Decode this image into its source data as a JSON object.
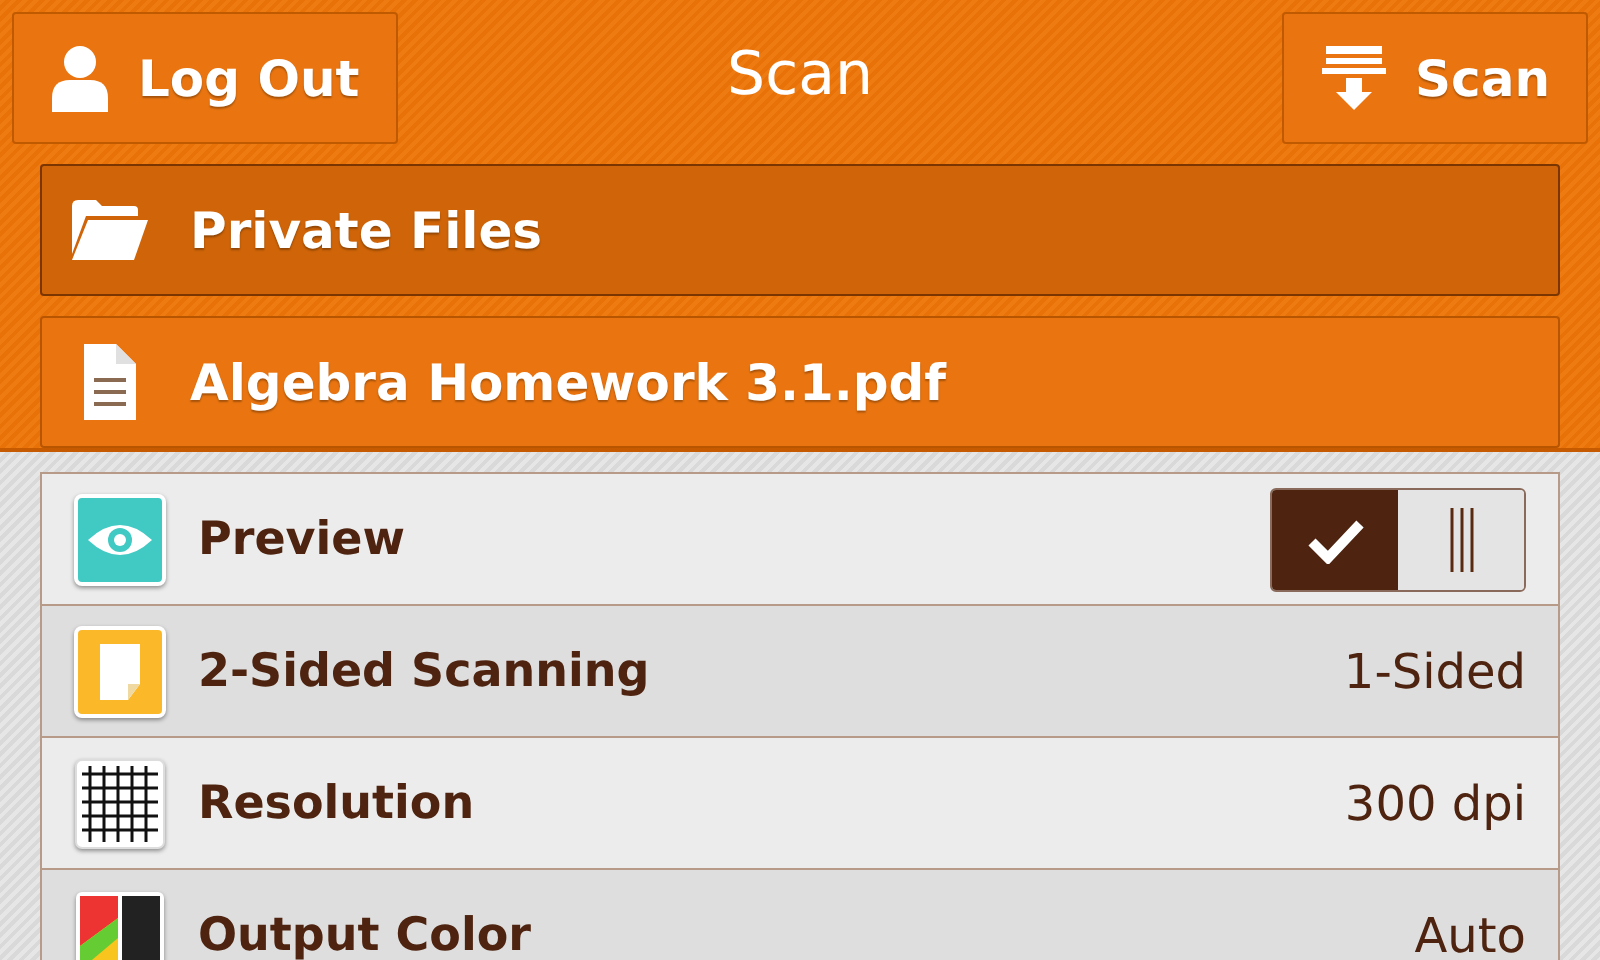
{
  "header": {
    "title": "Scan",
    "logout_button": "Log Out",
    "scan_button": "Scan"
  },
  "locations": [
    {
      "kind": "folder",
      "label": "Private Files",
      "selected": true
    },
    {
      "kind": "document",
      "label": "Algebra Homework 3.1.pdf",
      "selected": false
    }
  ],
  "settings": [
    {
      "kind": "toggle",
      "label": "Preview",
      "on": true
    },
    {
      "kind": "value",
      "label": "2-Sided Scanning",
      "value": "1-Sided"
    },
    {
      "kind": "value",
      "label": "Resolution",
      "value": "300 dpi"
    },
    {
      "kind": "value",
      "label": "Output Color",
      "value": "Auto"
    }
  ]
}
